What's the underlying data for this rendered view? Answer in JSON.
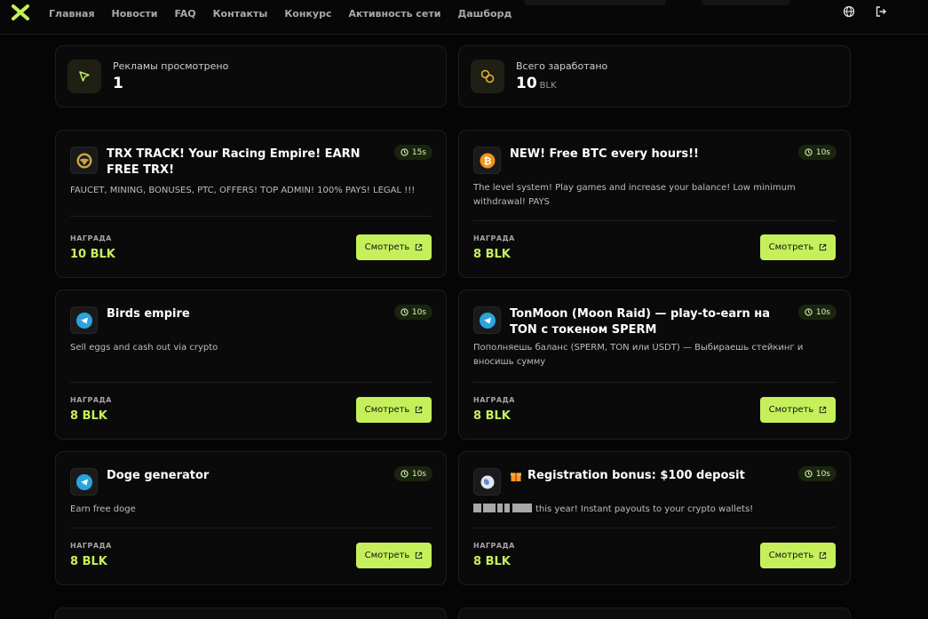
{
  "nav": {
    "items": [
      "Главная",
      "Новости",
      "FAQ",
      "Контакты",
      "Конкурс",
      "Активность сети",
      "Дашборд"
    ]
  },
  "stats": {
    "ads_viewed": {
      "label": "Рекламы просмотрено",
      "value": "1"
    },
    "earned": {
      "label": "Всего заработано",
      "value": "10",
      "unit": "BLK"
    }
  },
  "offers": [
    {
      "title": "TRX TRACK! Your Racing Empire! EARN FREE TRX!",
      "timer": "15s",
      "description": "FAUCET, MINING, BONUSES, PTC, OFFERS! TOP ADMIN! 100% PAYS! LEGAL !!!",
      "reward_label": "НАГРАДА",
      "reward": "10 BLK",
      "button": "Смотреть",
      "icon": "steering-wheel-icon"
    },
    {
      "title": "NEW! Free BTC every hours!!",
      "timer": "10s",
      "description": "The level system! Play games and increase your balance! Low minimum withdrawal! PAYS",
      "reward_label": "НАГРАДА",
      "reward": "8 BLK",
      "button": "Смотреть",
      "icon": "bitcoin-icon"
    },
    {
      "title": "Birds empire",
      "timer": "10s",
      "description": "Sell eggs and cash out via crypto",
      "reward_label": "НАГРАДА",
      "reward": "8 BLK",
      "button": "Смотреть",
      "icon": "telegram-icon"
    },
    {
      "title": "TonMoon (Moon Raid) — play-to-earn на TON с токеном SPERM",
      "timer": "10s",
      "description": "Пополняешь баланс (SPERM, TON или USDT) — Выбираешь стейкинг и вносишь сумму",
      "reward_label": "НАГРАДА",
      "reward": "8 BLK",
      "button": "Смотреть",
      "icon": "telegram-icon"
    },
    {
      "title": "Doge generator",
      "timer": "10s",
      "description": "Earn free doge",
      "reward_label": "НАГРАДА",
      "reward": "8 BLK",
      "button": "Смотреть",
      "icon": "telegram-icon"
    },
    {
      "title": "Registration bonus: $100 deposit",
      "timer": "10s",
      "description": "this year! Instant payouts to your crypto wallets!",
      "reward_label": "НАГРАДА",
      "reward": "8 BLK",
      "button": "Смотреть",
      "icon": "globe-icon"
    }
  ],
  "colors": {
    "accent": "#c5f05c",
    "background": "#050505",
    "card": "#0a0a0a"
  }
}
